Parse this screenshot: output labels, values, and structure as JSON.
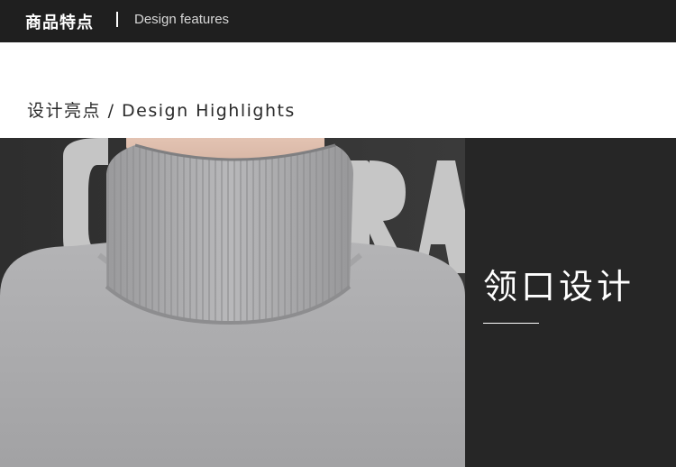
{
  "header": {
    "title_cn": "商品特点",
    "title_en": "Design features"
  },
  "section": {
    "title_cn": "设计亮点",
    "separator": "/",
    "title_en": "Design Highlights"
  },
  "feature": {
    "label": "领口设计"
  },
  "colors": {
    "header_bg": "#1f1f1f",
    "panel_bg": "#262626",
    "sweater": "#a9a9ab"
  }
}
